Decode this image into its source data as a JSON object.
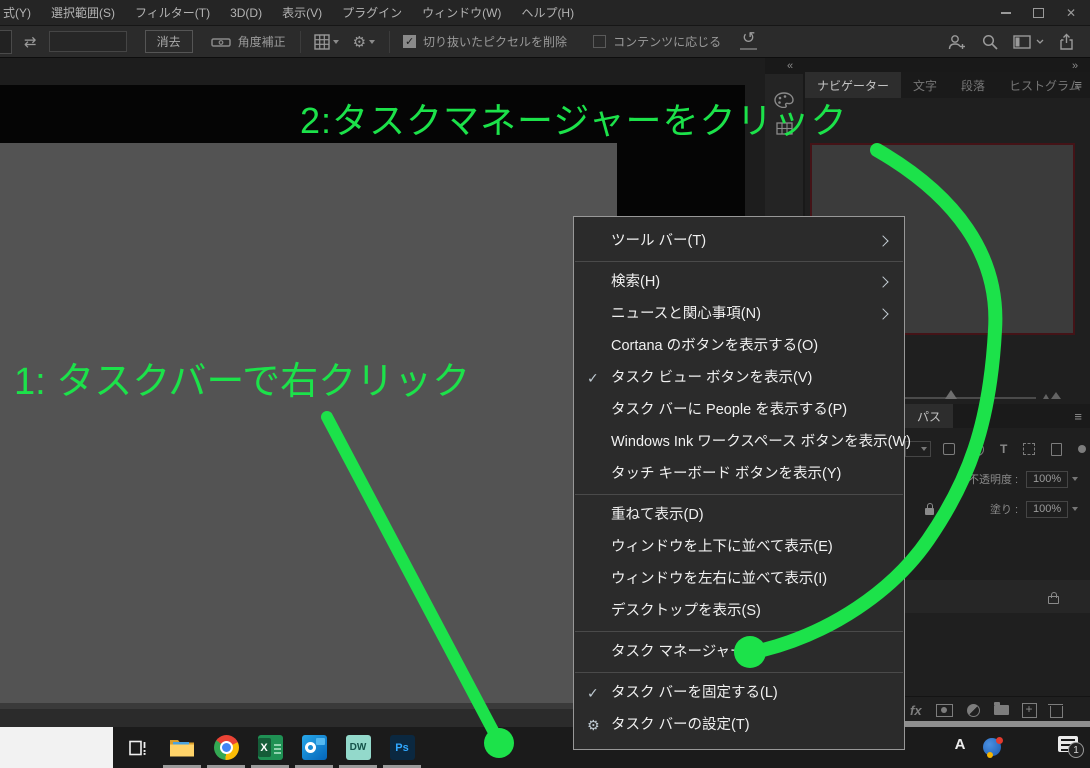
{
  "photoshop": {
    "menu_items": [
      "式(Y)",
      "選択範囲(S)",
      "フィルター(T)",
      "3D(D)",
      "表示(V)",
      "プラグイン",
      "ウィンドウ(W)",
      "ヘルプ(H)"
    ],
    "options_bar": {
      "clear_button": "消去",
      "straighten_label": "角度補正",
      "delete_pixels_label": "切り抜いたピクセルを削除",
      "content_aware_label": "コンテンツに応じる"
    },
    "panel_tabs": [
      "ナビゲーター",
      "文字",
      "段落",
      "ヒストグラム"
    ],
    "paths_panel": {
      "tab": "パス",
      "opacity_label": "不透明度 :",
      "opacity_value": "100%",
      "fill_label": "塗り :",
      "fill_value": "100%",
      "type_icon": "T",
      "fx_label": "fx"
    }
  },
  "icons": {
    "collapse": "«",
    "expand": "»",
    "hamburger": "≡",
    "swap": "⇄",
    "gear": "⚙",
    "undo": "↺",
    "check": "✓",
    "close": "✕"
  },
  "context_menu": {
    "items": [
      {
        "label": "ツール バー(T)",
        "submenu": true
      },
      {
        "label": "検索(H)",
        "submenu": true
      },
      {
        "label": "ニュースと関心事項(N)",
        "submenu": true
      },
      {
        "label": "Cortana のボタンを表示する(O)"
      },
      {
        "label": "タスク ビュー ボタンを表示(V)",
        "checked": true
      },
      {
        "label": "タスク バーに People を表示する(P)"
      },
      {
        "label": "Windows Ink ワークスペース ボタンを表示(W)"
      },
      {
        "label": "タッチ キーボード ボタンを表示(Y)"
      },
      {
        "label": "重ねて表示(D)"
      },
      {
        "label": "ウィンドウを上下に並べて表示(E)"
      },
      {
        "label": "ウィンドウを左右に並べて表示(I)"
      },
      {
        "label": "デスクトップを表示(S)"
      },
      {
        "label": "タスク マネージャー(K)"
      },
      {
        "label": "タスク バーを固定する(L)",
        "checked": true
      },
      {
        "label": "タスク バーの設定(T)",
        "gear": true
      }
    ]
  },
  "taskbar": {
    "apps": [
      "task-view",
      "file-explorer",
      "chrome",
      "excel",
      "outlook",
      "dreamweaver",
      "photoshop"
    ],
    "excel_letter": "X",
    "dw_text": "DW",
    "ps_text": "Ps",
    "ime_label": "A",
    "notification_count": "1"
  },
  "annotations": {
    "color": "#1ce24a",
    "step1": "1: タスクバーで右クリック",
    "step2": "2:タスクマネージャーをクリック"
  }
}
